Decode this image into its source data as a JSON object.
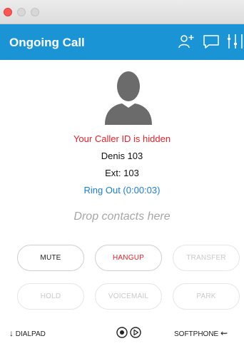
{
  "window": {
    "controls": [
      "close",
      "minimize",
      "zoom"
    ]
  },
  "header": {
    "title": "Ongoing Call",
    "icons": [
      "add-contact-icon",
      "chat-icon",
      "settings-sliders-icon"
    ],
    "background": "#1a94d4"
  },
  "call": {
    "caller_id_notice": "Your Caller ID is hidden",
    "name": "Denis 103",
    "ext": "Ext: 103",
    "status": "Ring Out (0:00:03)",
    "drop_hint": "Drop contacts here"
  },
  "buttons": {
    "mute": "MUTE",
    "hangup": "HANGUP",
    "transfer": "TRANSFER",
    "hold": "HOLD",
    "voicemail": "VOICEMAIL",
    "park": "PARK"
  },
  "footer": {
    "dialpad": "DIALPAD",
    "softphone": "SOFTPHONE"
  },
  "colors": {
    "accent": "#1a94d4",
    "hangup": "#e8202a",
    "status": "#1a7fd0",
    "disabled": "#c9c9c9"
  }
}
